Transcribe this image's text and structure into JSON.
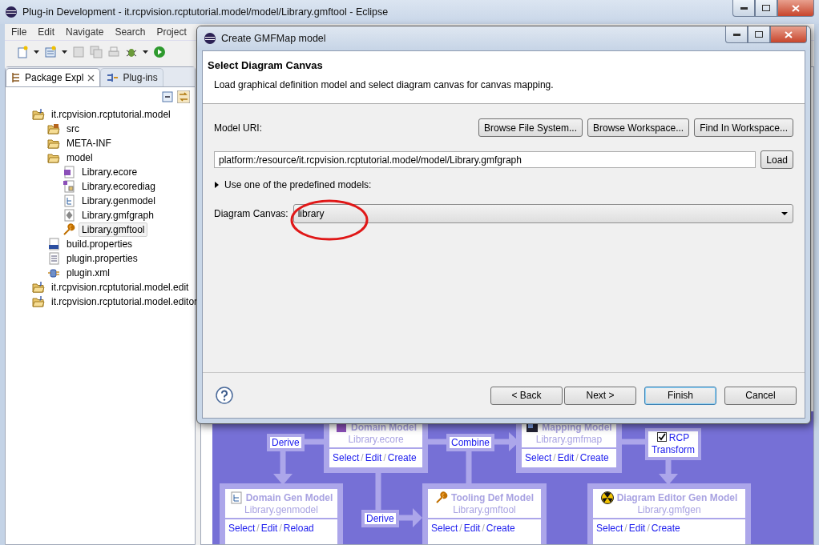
{
  "window": {
    "title": "Plug-in Development - it.rcpvision.rcptutorial.model/model/Library.gmftool - Eclipse"
  },
  "menu": [
    "File",
    "Edit",
    "Navigate",
    "Search",
    "Project"
  ],
  "view_tabs": [
    {
      "label": "Package Expl",
      "selected": true
    },
    {
      "label": "Plug-ins",
      "selected": false
    }
  ],
  "tree": [
    {
      "label": "it.rcpvision.rcptutorial.model",
      "kind": "project",
      "selected": false,
      "children": [
        {
          "label": "src",
          "kind": "source-folder",
          "selected": false
        },
        {
          "label": "META-INF",
          "kind": "folder",
          "selected": false
        },
        {
          "label": "model",
          "kind": "folder",
          "selected": false,
          "children": [
            {
              "label": "Library.ecore",
              "kind": "ecore",
              "selected": false
            },
            {
              "label": "Library.ecorediag",
              "kind": "ecorediag",
              "selected": false
            },
            {
              "label": "Library.genmodel",
              "kind": "genmodel",
              "selected": false
            },
            {
              "label": "Library.gmfgraph",
              "kind": "gmfgraph",
              "selected": false
            },
            {
              "label": "Library.gmftool",
              "kind": "gmftool",
              "selected": true
            }
          ]
        },
        {
          "label": "build.properties",
          "kind": "binary-file",
          "selected": false
        },
        {
          "label": "plugin.properties",
          "kind": "text-file",
          "selected": false
        },
        {
          "label": "plugin.xml",
          "kind": "plugin-file",
          "selected": false
        }
      ]
    },
    {
      "label": "it.rcpvision.rcptutorial.model.edit",
      "kind": "project",
      "selected": false
    },
    {
      "label": "it.rcpvision.rcptutorial.model.editor",
      "kind": "project",
      "selected": false
    }
  ],
  "dialog": {
    "title": "Create GMFMap model",
    "heading": "Select Diagram Canvas",
    "description": "Load graphical definition model and select diagram canvas for canvas mapping.",
    "model_uri_label": "Model URI:",
    "browse_buttons": [
      "Browse File System...",
      "Browse Workspace...",
      "Find In Workspace..."
    ],
    "uri_value": "platform:/resource/it.rcpvision.rcptutorial.model/model/Library.gmfgraph",
    "load_button": "Load",
    "predefined": {
      "label": "Use one of the predefined models:",
      "expanded": false
    },
    "canvas_label": "Diagram Canvas:",
    "canvas_value": "library",
    "buttons": [
      {
        "label": "< Back",
        "default": false,
        "disabled": false
      },
      {
        "label": "Next >",
        "default": false,
        "disabled": false
      },
      {
        "label": "Finish",
        "default": true,
        "disabled": false
      },
      {
        "label": "Cancel",
        "default": false,
        "disabled": false
      }
    ]
  },
  "diagram": {
    "separator": "/",
    "nodes": [
      {
        "title": "Domain Model",
        "file": "Library.ecore",
        "kind": "ecore",
        "actions": [
          "Select",
          "Edit",
          "Create"
        ]
      },
      {
        "title": "Mapping Model",
        "file": "Library.gmfmap",
        "kind": "gmfmap",
        "actions": [
          "Select",
          "Edit",
          "Create"
        ]
      },
      {
        "title": "Domain Gen Model",
        "file": "Library.genmodel",
        "kind": "genmodel",
        "actions": [
          "Select",
          "Edit",
          "Reload"
        ]
      },
      {
        "title": "Tooling Def Model",
        "file": "Library.gmftool",
        "kind": "gmftool",
        "actions": [
          "Select",
          "Edit",
          "Create"
        ]
      },
      {
        "title": "Diagram Editor Gen Model",
        "file": "Library.gmfgen",
        "kind": "gmfgen",
        "actions": [
          "Select",
          "Edit",
          "Create"
        ]
      }
    ],
    "labels": [
      "Derive",
      "Combine",
      "Derive"
    ],
    "transform": {
      "label": "RCP Transform",
      "checked": true
    }
  }
}
